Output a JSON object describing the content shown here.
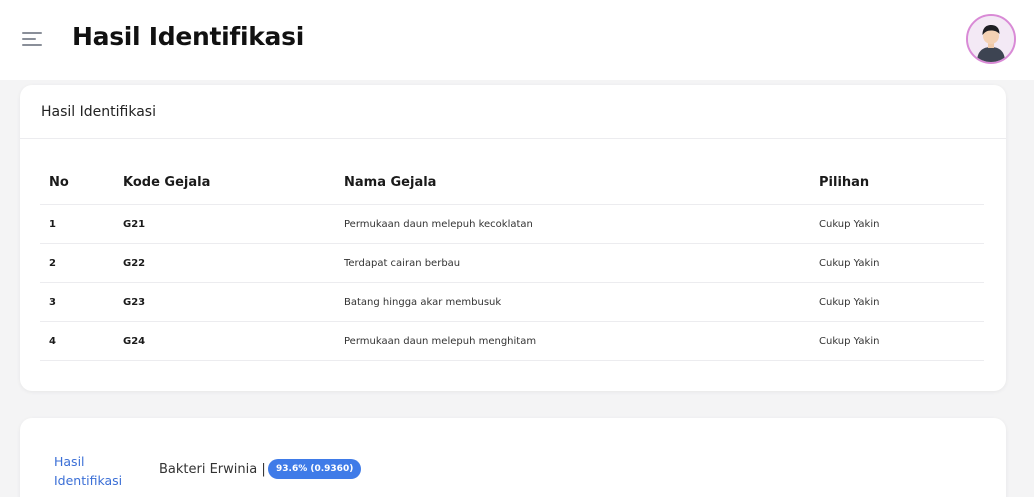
{
  "header": {
    "title": "Hasil Identifikasi",
    "menu_icon": "hamburger-menu-icon",
    "avatar_icon": "user-avatar-icon"
  },
  "symptoms_card": {
    "title": "Hasil Identifikasi",
    "columns": [
      "No",
      "Kode Gejala",
      "Nama Gejala",
      "Pilihan"
    ],
    "rows": [
      {
        "no": "1",
        "kode": "G21",
        "nama": "Permukaan daun melepuh kecoklatan",
        "pilihan": "Cukup Yakin"
      },
      {
        "no": "2",
        "kode": "G22",
        "nama": "Terdapat cairan berbau",
        "pilihan": "Cukup Yakin"
      },
      {
        "no": "3",
        "kode": "G23",
        "nama": "Batang hingga akar membusuk",
        "pilihan": "Cukup Yakin"
      },
      {
        "no": "4",
        "kode": "G24",
        "nama": "Permukaan daun melepuh menghitam",
        "pilihan": "Cukup Yakin"
      }
    ]
  },
  "result_card": {
    "label": "Hasil Identifikasi",
    "value": "Bakteri Erwinia |",
    "badge": "93.6% (0.9360)"
  },
  "colors": {
    "accent": "#3f7be8",
    "link": "#3b6fd6",
    "background": "#f4f4f5",
    "avatar_border": "#d98ad6"
  }
}
